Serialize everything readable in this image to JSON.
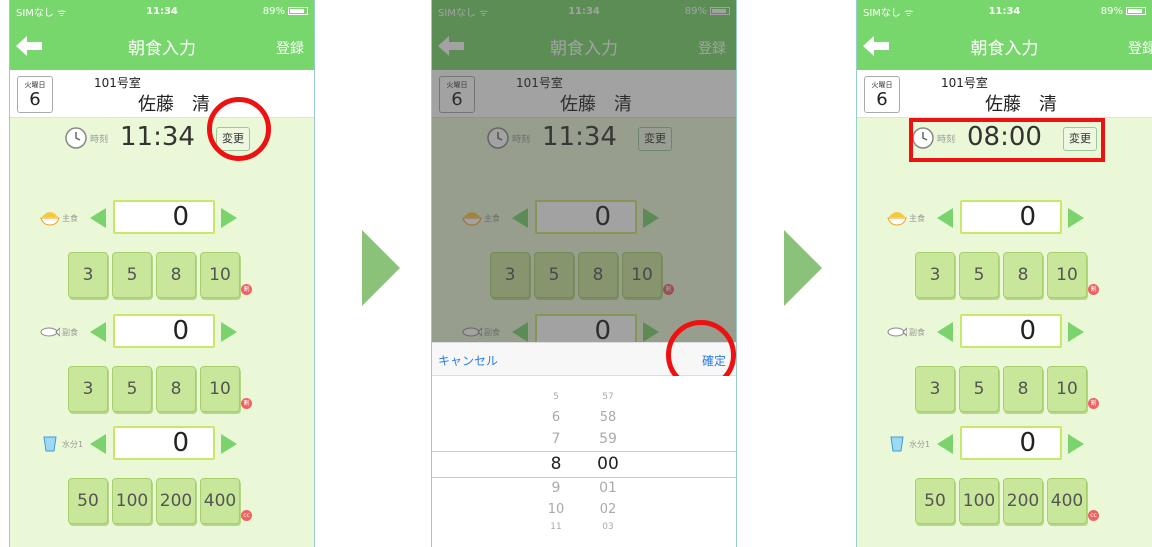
{
  "status": {
    "carrier": "SIMなし ᯤ",
    "time": "11:34",
    "battery": "89%"
  },
  "nav": {
    "title": "朝食入力",
    "register": "登録"
  },
  "info": {
    "weekday": "火曜日",
    "day": "6",
    "room": "101号室",
    "name": "佐藤　清"
  },
  "time_label": "時刻",
  "change_label": "変更",
  "screens": [
    {
      "time": "11:34"
    },
    {
      "time": "11:34"
    },
    {
      "time": "08:00"
    }
  ],
  "rows": {
    "staple": {
      "label": "主食",
      "value": "0",
      "buttons": [
        "3",
        "5",
        "8",
        "10"
      ],
      "unit": "割"
    },
    "side": {
      "label": "副食",
      "value": "0",
      "buttons": [
        "3",
        "5",
        "8",
        "10"
      ],
      "unit": "割"
    },
    "water": {
      "label": "水分1",
      "value": "0",
      "buttons": [
        "50",
        "100",
        "200",
        "400"
      ],
      "unit": "cc"
    }
  },
  "picker": {
    "cancel": "キャンセル",
    "confirm": "確定",
    "hours": [
      "5",
      "6",
      "7",
      "8",
      "9",
      "10",
      "11"
    ],
    "minutes": [
      "57",
      "58",
      "59",
      "00",
      "01",
      "02",
      "03"
    ]
  },
  "colors": {
    "nav": "#78d76c",
    "background": "#eaf8d8",
    "button": "#c9e79a",
    "highlight": "#ee1111",
    "link": "#2a7be5"
  }
}
